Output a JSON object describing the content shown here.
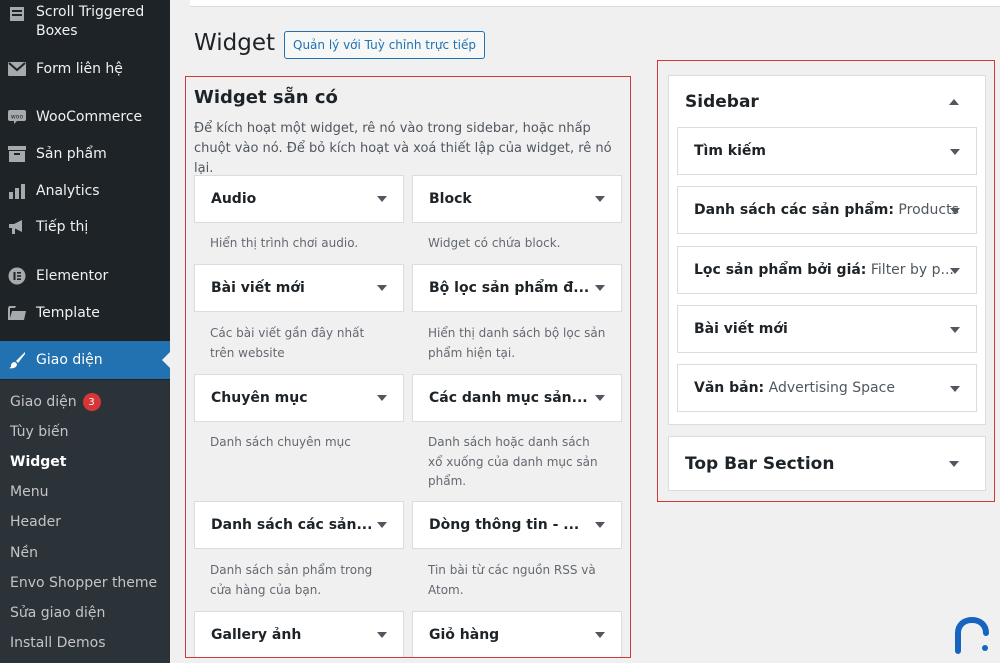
{
  "menu": [
    {
      "label": "Scroll Triggered Boxes",
      "icon": "boxes-icon"
    },
    {
      "label": "Form liên hệ",
      "icon": "mail-icon"
    },
    {
      "label": "WooCommerce",
      "icon": "woocommerce-icon"
    },
    {
      "label": "Sản phẩm",
      "icon": "archive-icon"
    },
    {
      "label": "Analytics",
      "icon": "bar-chart-icon"
    },
    {
      "label": "Tiếp thị",
      "icon": "megaphone-icon"
    },
    {
      "label": "Elementor",
      "icon": "elementor-icon"
    },
    {
      "label": "Template",
      "icon": "folder-icon"
    },
    {
      "label": "Giao diện",
      "icon": "paintbrush-icon"
    }
  ],
  "submenu": [
    {
      "label": "Giao diện",
      "badge": "3"
    },
    {
      "label": "Tùy biến"
    },
    {
      "label": "Widget"
    },
    {
      "label": "Menu"
    },
    {
      "label": "Header"
    },
    {
      "label": "Nền"
    },
    {
      "label": "Envo Shopper theme"
    },
    {
      "label": "Sửa giao diện"
    },
    {
      "label": "Install Demos"
    }
  ],
  "page": {
    "title": "Widget",
    "manage_button": "Quản lý với Tuỳ chỉnh trực tiếp"
  },
  "available": {
    "title": "Widget sẵn có",
    "description": "Để kích hoạt một widget, rê nó vào trong sidebar, hoặc nhấp chuột vào nó. Để bỏ kích hoạt và xoá thiết lập của widget, rê nó lại.",
    "widgets": [
      {
        "title": "Audio",
        "desc": "Hiển thị trình chơi audio."
      },
      {
        "title": "Block",
        "desc": "Widget có chứa block."
      },
      {
        "title": "Bài viết mới",
        "desc": "Các bài viết gần đây nhất trên website"
      },
      {
        "title": "Bộ lọc sản phẩm đ...",
        "desc": "Hiển thị danh sách bộ lọc sản phẩm hiện tại."
      },
      {
        "title": "Chuyên mục",
        "desc": "Danh sách chuyên mục"
      },
      {
        "title": "Các danh mục sản...",
        "desc": "Danh sách hoặc danh sách xổ xuống của danh mục sản phẩm."
      },
      {
        "title": "Danh sách các sản...",
        "desc": "Danh sách sản phẩm trong cửa hàng của bạn."
      },
      {
        "title": "Dòng thông tin - ...",
        "desc": "Tin bài từ các nguồn RSS và Atom."
      },
      {
        "title": "Gallery ảnh",
        "desc": ""
      },
      {
        "title": "Giỏ hàng",
        "desc": ""
      }
    ]
  },
  "sidebar_area": {
    "title": "Sidebar",
    "widgets": [
      {
        "title": "Tìm kiếm",
        "instance": ""
      },
      {
        "title": "Danh sách các sản phẩm:",
        "instance": "Products"
      },
      {
        "title": "Lọc sản phẩm bởi giá:",
        "instance": "Filter by p..."
      },
      {
        "title": "Bài viết mới",
        "instance": ""
      },
      {
        "title": "Văn bản:",
        "instance": "Advertising Space"
      }
    ]
  },
  "top_bar_area": {
    "title": "Top Bar Section"
  },
  "colors": {
    "sidebar_bg": "#1d2327",
    "active_menu": "#2271b1",
    "highlight_border": "#d63638",
    "badge": "#d63638"
  }
}
